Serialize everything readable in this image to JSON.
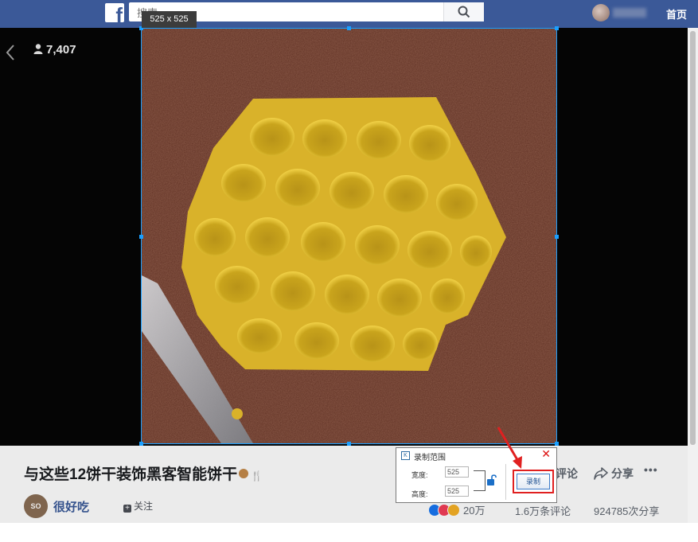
{
  "topbar": {
    "logo_letter": "f",
    "search_placeholder": "搜索",
    "home_label": "首页"
  },
  "viewer": {
    "view_count": "7,407"
  },
  "selection": {
    "dimensions_label": "525 x 525"
  },
  "post": {
    "title": "与这些12饼干装饰黑客智能饼干",
    "page_avatar_text": "SO YUMMY",
    "page_name": "很好吃",
    "follow_label": "关注",
    "comment_label": "评论",
    "share_label": "分享",
    "more_label": "•••",
    "reactions_count": "20万",
    "comments_count": "1.6万条评论",
    "shares_count": "924785次分享"
  },
  "record_dialog": {
    "title": "录制范围",
    "close": "✕",
    "width_label": "宽度:",
    "width_value": "525",
    "height_label": "高度:",
    "height_value": "525",
    "record_button": "录制"
  },
  "colors": {
    "facebook_blue": "#3b5998",
    "selection_blue": "#1a9fff",
    "highlight_red": "#e02020"
  }
}
